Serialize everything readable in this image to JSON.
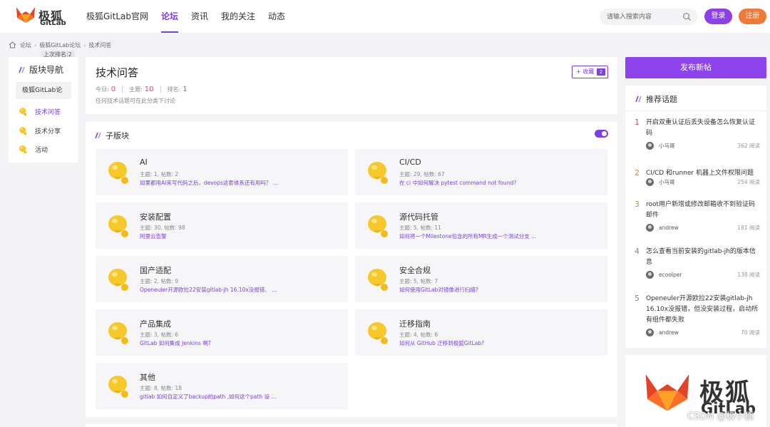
{
  "header": {
    "logo_cn": "极狐",
    "logo_en": "GitLab",
    "nav": [
      "极狐GitLab官网",
      "论坛",
      "资讯",
      "我的关注",
      "动态"
    ],
    "active_nav": 1,
    "search_placeholder": "请输入搜索内容",
    "login_label": "登录",
    "register_label": "注册",
    "accent": "#7b3fe4",
    "register_color": "#ee7a3a"
  },
  "breadcrumb": {
    "items": [
      "论坛",
      "极狐GitLab论坛",
      "技术问答"
    ],
    "tooltip": "上次排名:2"
  },
  "leftnav": {
    "title": "版块导航",
    "group": "极狐GitLab论",
    "items": [
      "技术问答",
      "技术分享",
      "活动"
    ],
    "active_item": 0
  },
  "forum": {
    "title": "技术问答",
    "today_label": "今日:",
    "today": "0",
    "topics_label": "主题:",
    "topics": "10",
    "rank_label": "排名:",
    "rank": "1",
    "description": "任何技术话题可在此分类下讨论",
    "favorite_label": "+ 收藏",
    "favorite_count": "2"
  },
  "subforums": {
    "title": "子版块",
    "toggle_on": true,
    "items": [
      {
        "name": "AI",
        "meta": "主题: 1, 帖数: 2",
        "latest": "如果都用AI来写代码之后，devops这套体系还有用吗？ ..."
      },
      {
        "name": "CI/CD",
        "meta": "主题: 29, 帖数: 67",
        "latest": "在 ci 中如何解决 pytest command not found?"
      },
      {
        "name": "安装配置",
        "meta": "主题: 30, 帖数: 98",
        "latest": "阿里云告警"
      },
      {
        "name": "源代码托管",
        "meta": "主题: 5, 帖数: 11",
        "latest": "如何将一个Milestone包含的所有MR生成一个测试分支 ..."
      },
      {
        "name": "国产适配",
        "meta": "主题: 2, 帖数: 9",
        "latest": "Openeuler开源欧拉22安装gitlab-jh 16.10x没报错、 ..."
      },
      {
        "name": "安全合规",
        "meta": "主题: 5, 帖数: 7",
        "latest": "如何使用GitLab对镜像进行扫描?"
      },
      {
        "name": "产品集成",
        "meta": "主题: 3, 帖数: 6",
        "latest": "GitLab 如何集成 Jenkins 啊?"
      },
      {
        "name": "迁移指南",
        "meta": "主题: 4, 帖数: 6",
        "latest": "如何从 GitHub 迁移到极狐GitLab?"
      },
      {
        "name": "其他",
        "meta": "主题: 8, 帖数: 18",
        "latest": "gitlab 如何自定义了backup的path ,如何这个path 设 ..."
      }
    ]
  },
  "sidebar": {
    "post_button": "发布新帖",
    "hot_title": "推荐话题",
    "topics": [
      {
        "rank": "1",
        "rank_color": "#e0407b",
        "title": "开启双重认证后丢失设备怎么恢复认证码",
        "user": "小马哥",
        "reads": "362 阅读"
      },
      {
        "rank": "2",
        "rank_color": "#ee7a3a",
        "title": "CI/CD 和runner 机器上文件权限问题",
        "user": "小马哥",
        "reads": "254 阅读"
      },
      {
        "rank": "3",
        "rank_color": "#8ab030",
        "title": "root用户新增或修改邮箱收不到验证码邮件",
        "user": "andrew",
        "reads": "181 阅读"
      },
      {
        "rank": "4",
        "rank_color": "#888888",
        "title": "怎么查看当前安装的gitlab-jh的版本信息",
        "user": "ecoolper",
        "reads": "138 阅读"
      },
      {
        "rank": "5",
        "rank_color": "#888888",
        "title": "Openeuler开源欧拉22安装gitlab-jh 16.10x没报错，但没安装过程，启动所有组件都失败",
        "user": "andrew",
        "reads": "70 阅读"
      }
    ],
    "brand_cn": "极狐",
    "brand_en": "GitLab"
  },
  "watermark": "CSDN @极小狐"
}
